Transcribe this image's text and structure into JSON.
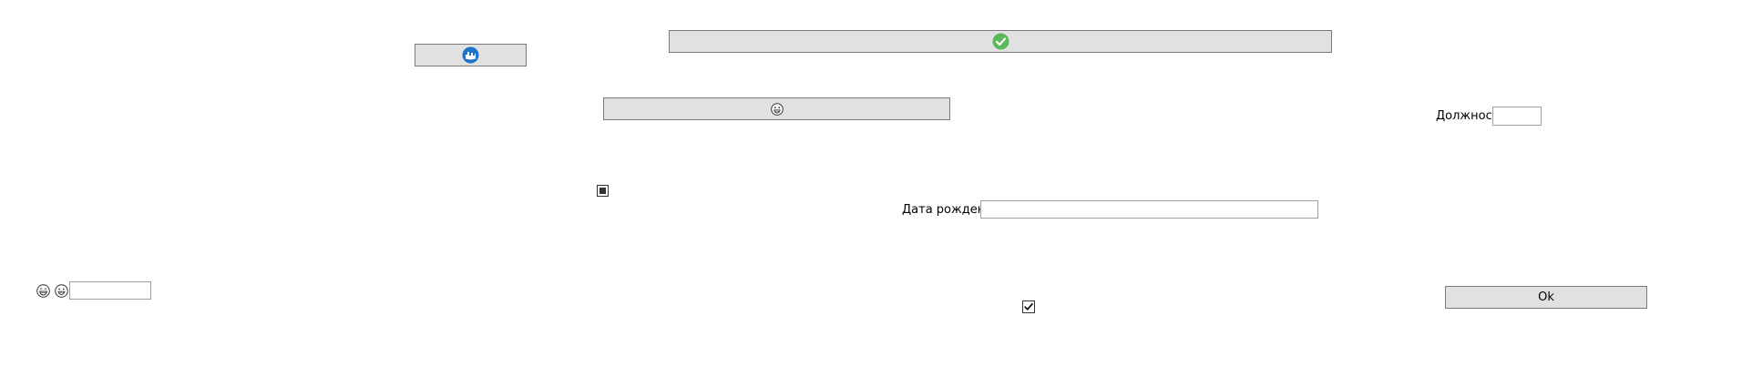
{
  "buttons": {
    "top_left_icon": "cloud-city-icon",
    "top_center_icon": "check-circle-icon",
    "middle_icon": "grin-face-icon",
    "ok_label": "Ok"
  },
  "labels": {
    "position": "Должность",
    "birth_date": "Дата рождения"
  },
  "fields": {
    "position_value": "",
    "birth_date_value": "",
    "bottom_left_value": ""
  },
  "checkboxes": {
    "upper_state": "indeterminate",
    "lower_state": "checked"
  },
  "icons": {
    "bottom_left_1": "laughing-face-icon",
    "bottom_left_2": "grinning-face-icon"
  },
  "colors": {
    "button_bg": "#e1e1e1",
    "check_green": "#5cb85c",
    "cloud_blue": "#1e73c8"
  }
}
